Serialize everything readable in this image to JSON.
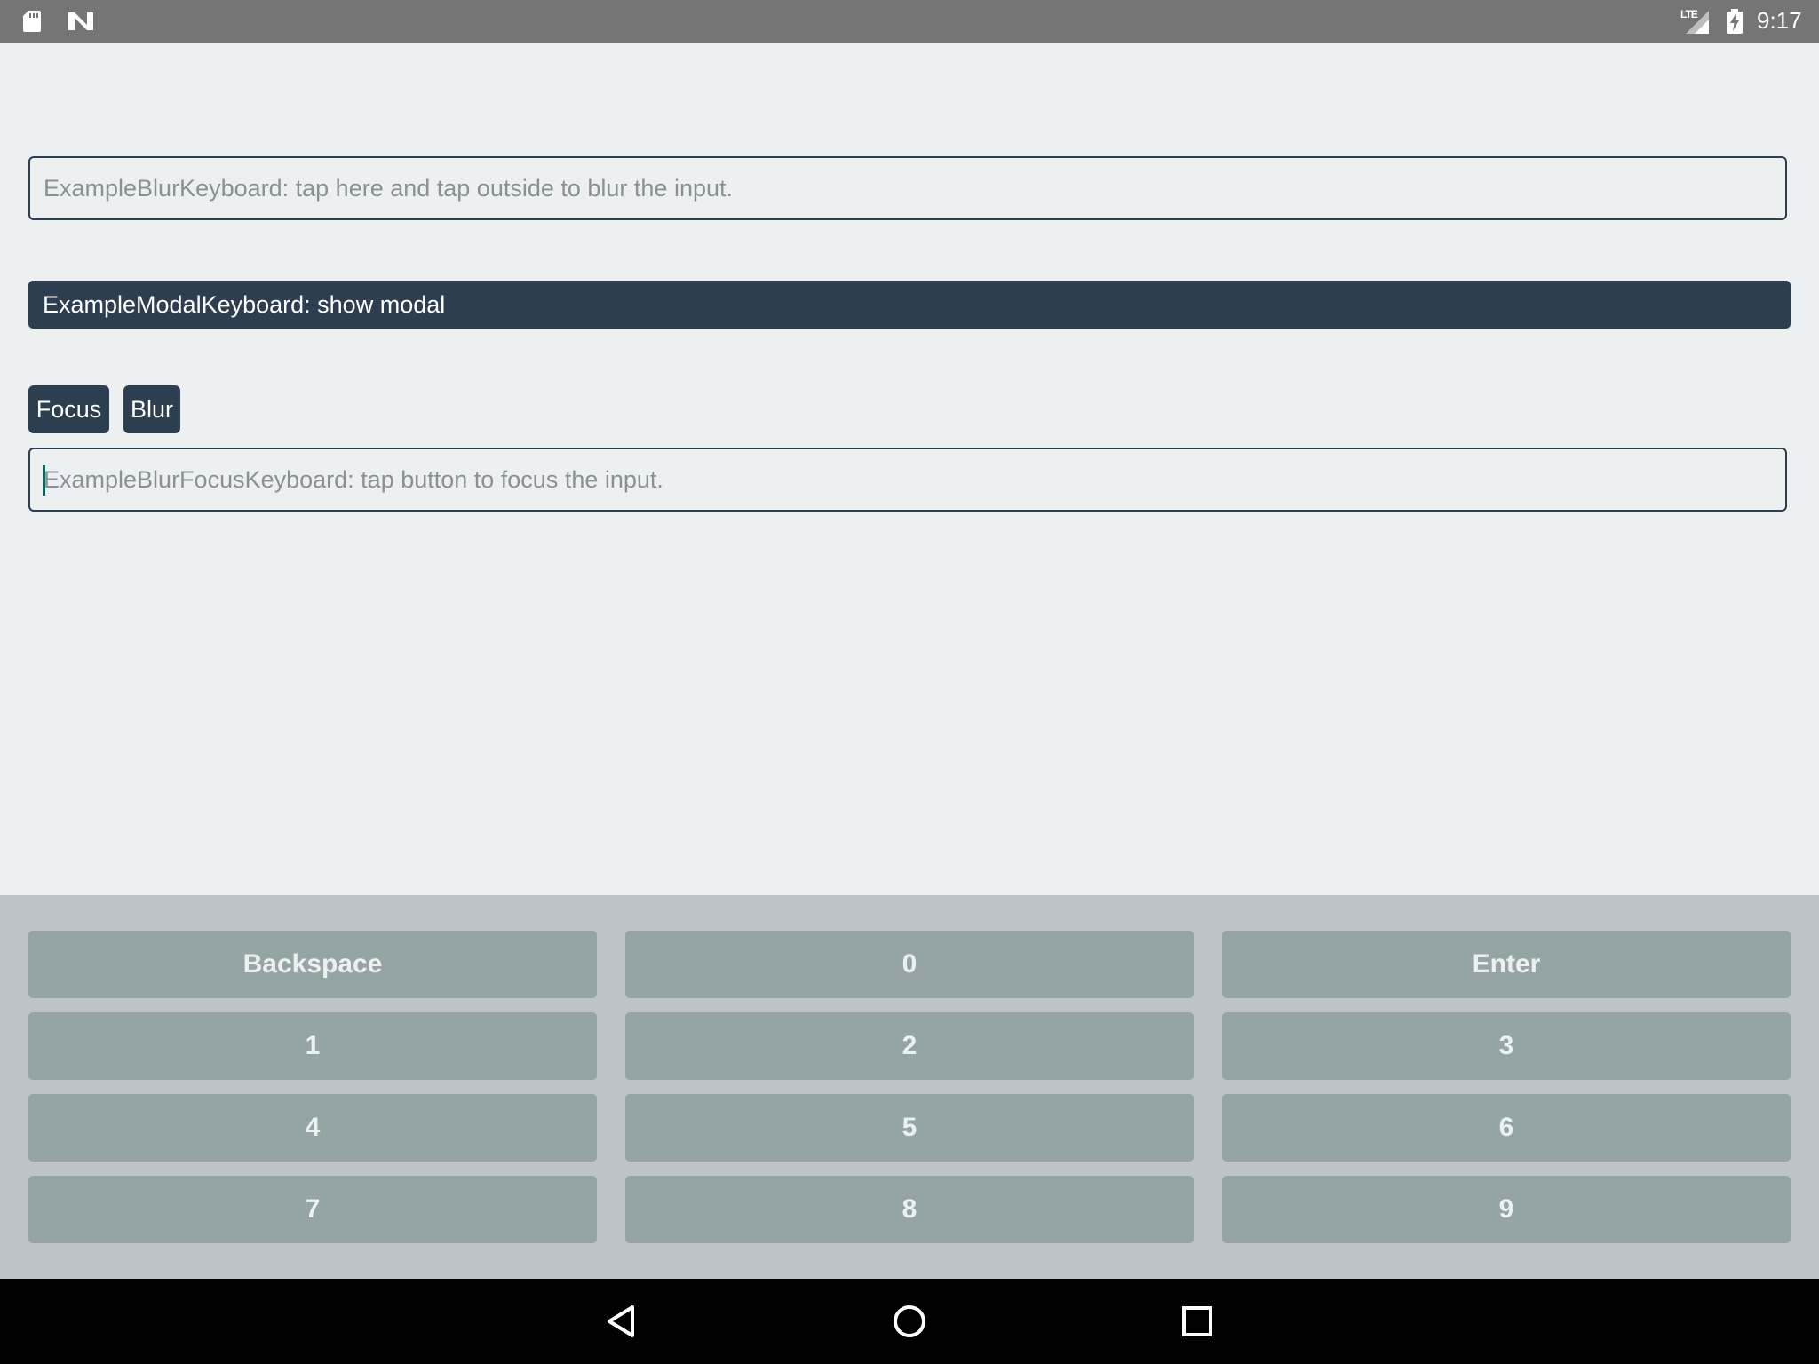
{
  "status_bar": {
    "network_label": "LTE",
    "time": "9:17",
    "icons": [
      "sd-card-icon",
      "n-notification-icon",
      "signal-icon",
      "battery-charging-icon"
    ]
  },
  "main": {
    "blur_input": {
      "placeholder": "ExampleBlurKeyboard: tap here and tap outside to blur the input.",
      "value": ""
    },
    "modal_button_label": "ExampleModalKeyboard: show modal",
    "focus_button_label": "Focus",
    "blur_button_label": "Blur",
    "focus_input": {
      "placeholder": "ExampleBlurFocusKeyboard: tap button to focus the input.",
      "value": ""
    }
  },
  "keyboard": {
    "keys": [
      "Backspace",
      "0",
      "Enter",
      "1",
      "2",
      "3",
      "4",
      "5",
      "6",
      "7",
      "8",
      "9"
    ]
  },
  "nav_bar": {
    "icons": [
      "back-icon",
      "home-icon",
      "recents-icon"
    ]
  },
  "colors": {
    "background": "#ECF0F1",
    "primary": "#2C3E50",
    "keyboard_bg": "#BDC3C7",
    "key_bg": "#95A5A6",
    "status_bar": "#757575"
  }
}
